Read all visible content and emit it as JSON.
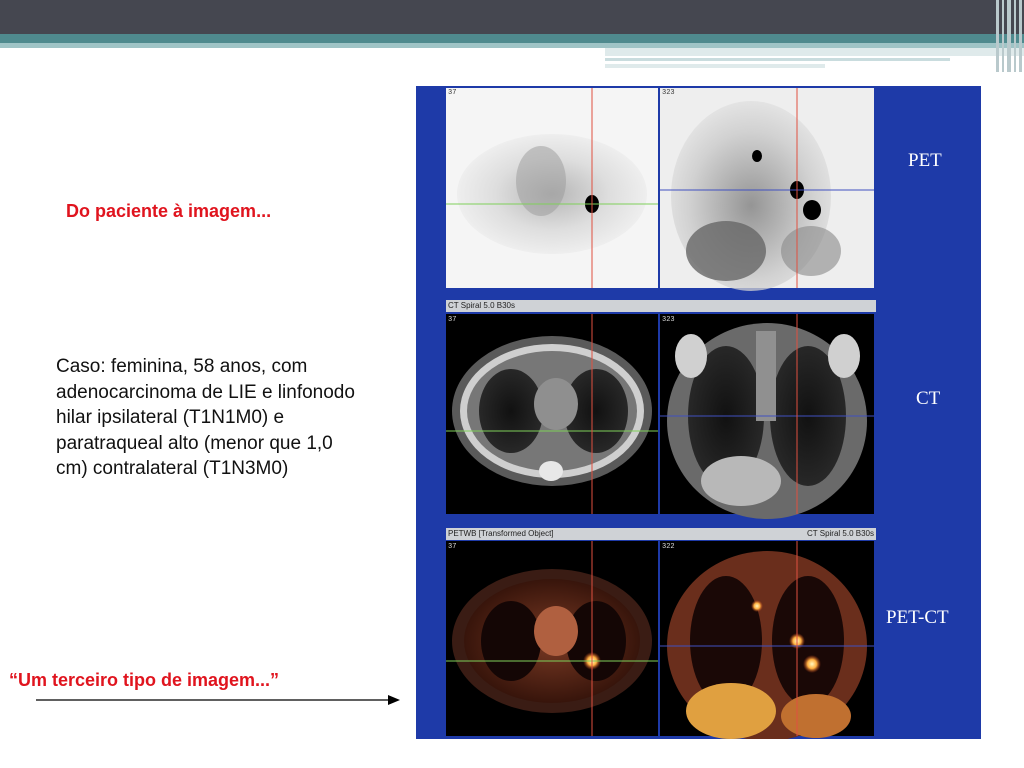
{
  "slide": {
    "heading": "Do paciente à imagem...",
    "case_text": "Caso: feminina, 58 anos, com adenocarcinoma de LIE e linfonodo hilar ipsilateral (T1N1M0) e paratraqueal alto (menor que 1,0 cm) contralateral (T1N3M0)",
    "quote": "“Um terceiro tipo de imagem...”"
  },
  "figure": {
    "row_labels": [
      "PET",
      "CT",
      "PET-CT"
    ],
    "strip_ct_left": "CT Spiral 5.0 B30s",
    "strip_fused_left": "PETWB [Transformed Object]",
    "strip_fused_right": "CT Spiral 5.0 B30s",
    "slice_axial": "37",
    "slice_coronal": "323",
    "slice_coronal_alt": "322"
  },
  "colors": {
    "accent_red": "#e0141e",
    "figure_blue": "#1e3aa8",
    "top_bar": "#454750",
    "teal_band": "#4f8a8e"
  }
}
